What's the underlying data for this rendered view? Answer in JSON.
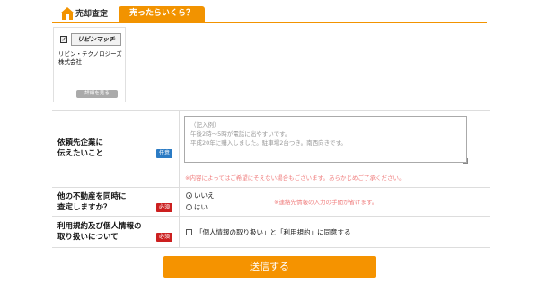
{
  "header": {
    "label": "売却査定",
    "tab_label": "売ったらいくら？"
  },
  "company": {
    "logo_text": "リビンマッチ",
    "name": "リビン・テクノロジーズ株式会社",
    "detail_button": "詳細を見る"
  },
  "form": {
    "message": {
      "label_line1": "依頼先企業に",
      "label_line2": "伝えたいこと",
      "badge": "任意",
      "placeholder": "（記入例）\n午後2時～5時が電話に出やすいです。\n平成20年に購入しました。駐車場2台つき。南西向きです。",
      "note": "※内容によってはご希望にそえない場合もございます。あらかじめご了承ください。"
    },
    "other_property": {
      "label_line1": "他の不動産を同時に",
      "label_line2": "査定しますか？",
      "badge": "必須",
      "options": [
        "いいえ",
        "はい"
      ],
      "selected": "いいえ",
      "note": "※連絡先情報の入力の手間が省けます。"
    },
    "terms": {
      "label_line1": "利用規約及び個人情報の",
      "label_line2": "取り扱いについて",
      "badge": "必須",
      "agree_text": "「個人情報の取り扱い」と「利用規約」に同意する"
    }
  },
  "submit_label": "送信する",
  "colors": {
    "accent": "#f29300",
    "required": "#cc1f1f",
    "optional": "#2b7bc4",
    "note": "#f08080"
  }
}
